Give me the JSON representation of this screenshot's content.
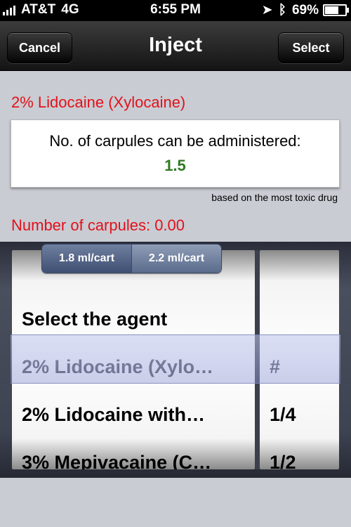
{
  "status_bar": {
    "carrier": "AT&T",
    "network": "4G",
    "time": "6:55 PM",
    "battery": "69%",
    "icons": [
      "signal-bars-icon",
      "location-arrow-icon",
      "bluetooth-icon",
      "battery-icon"
    ]
  },
  "nav": {
    "title": "Inject",
    "cancel_label": "Cancel",
    "select_label": "Select"
  },
  "agent_title": "2% Lidocaine (Xylocaine)",
  "result": {
    "label": "No. of carpules can be administered:",
    "value": "1.5"
  },
  "note": "based on the most toxic drug",
  "carpules_line": "Number of carpules:  0.00",
  "segmented": {
    "options": [
      "1.8 ml/cart",
      "2.2 ml/cart"
    ],
    "selected": "1.8 ml/cart"
  },
  "picker": {
    "agents": [
      "Select the agent",
      "2% Lidocaine (Xylo…",
      "2% Lidocaine with…",
      "3% Mepivacaine (C…"
    ],
    "fractions": [
      "",
      "#",
      "1/4",
      "1/2"
    ],
    "selected_agent": "2% Lidocaine (Xylo…",
    "selected_fraction": "#"
  },
  "colors": {
    "title_red": "#e3111b",
    "value_green": "#2f7a20",
    "background": "#c9ccd3"
  }
}
